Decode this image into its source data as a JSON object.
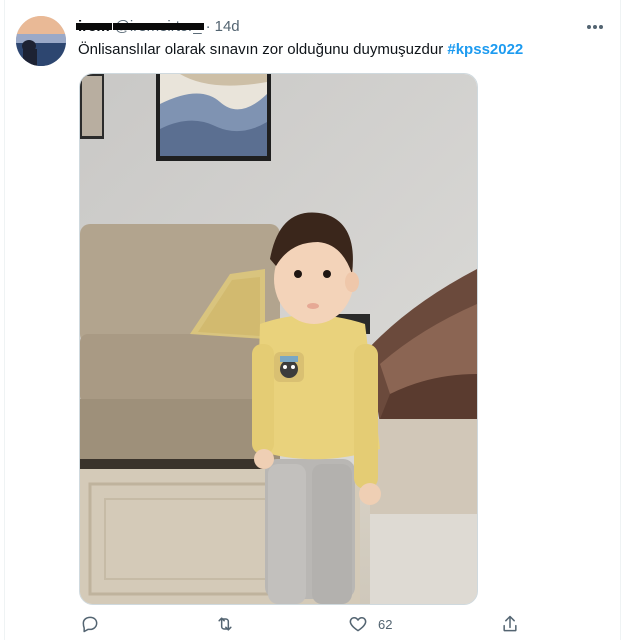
{
  "tweet": {
    "author": {
      "display_name": "irem",
      "handle": "@iremeirtor_"
    },
    "separator": "·",
    "timestamp": "14d",
    "text": "Önlisanslılar olarak sınavın zor olduğunu duymuşuzdur",
    "hashtag": "#kpss2022"
  },
  "actions": {
    "like_count": "62"
  },
  "icons": {
    "more": "more-horizontal-icon",
    "reply": "reply-icon",
    "retweet": "retweet-icon",
    "like": "heart-icon",
    "share": "share-icon"
  },
  "colors": {
    "hashtag": "#1d9bf0",
    "secondary_text": "#536471",
    "border": "#cfd9de"
  }
}
